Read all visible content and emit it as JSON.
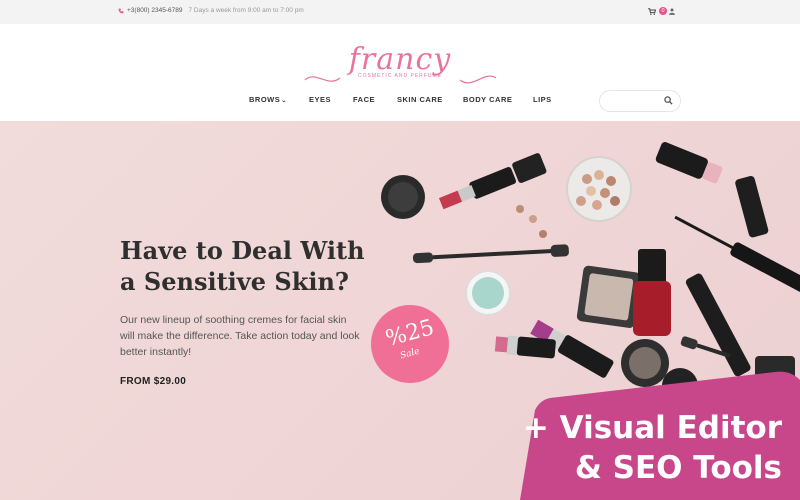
{
  "topbar": {
    "phone": "+3(800) 2345-6789",
    "hours": "7 Days a week from 9:00 am to 7:00 pm",
    "cart_count": "0"
  },
  "logo": {
    "name": "francy",
    "tagline": "COSMETIC AND PERFUME"
  },
  "nav": {
    "items": [
      {
        "label": "BROWS"
      },
      {
        "label": "EYES"
      },
      {
        "label": "FACE"
      },
      {
        "label": "SKIN CARE"
      },
      {
        "label": "BODY CARE"
      },
      {
        "label": "LIPS"
      }
    ]
  },
  "search": {
    "placeholder": ""
  },
  "hero": {
    "title_line1": "Have to Deal With",
    "title_line2": "a Sensitive Skin?",
    "description": "Our new lineup of soothing cremes for facial skin will make the difference. Take action today and look better instantly!",
    "price": "FROM $29.00"
  },
  "badge": {
    "percent": "%25",
    "word": "Sale"
  },
  "promo": {
    "line1": "+ Visual Editor",
    "line2": "& SEO Tools"
  },
  "colors": {
    "accent": "#e8558a",
    "promo": "#c8478b",
    "hero_bg": "#f0d8d8"
  }
}
